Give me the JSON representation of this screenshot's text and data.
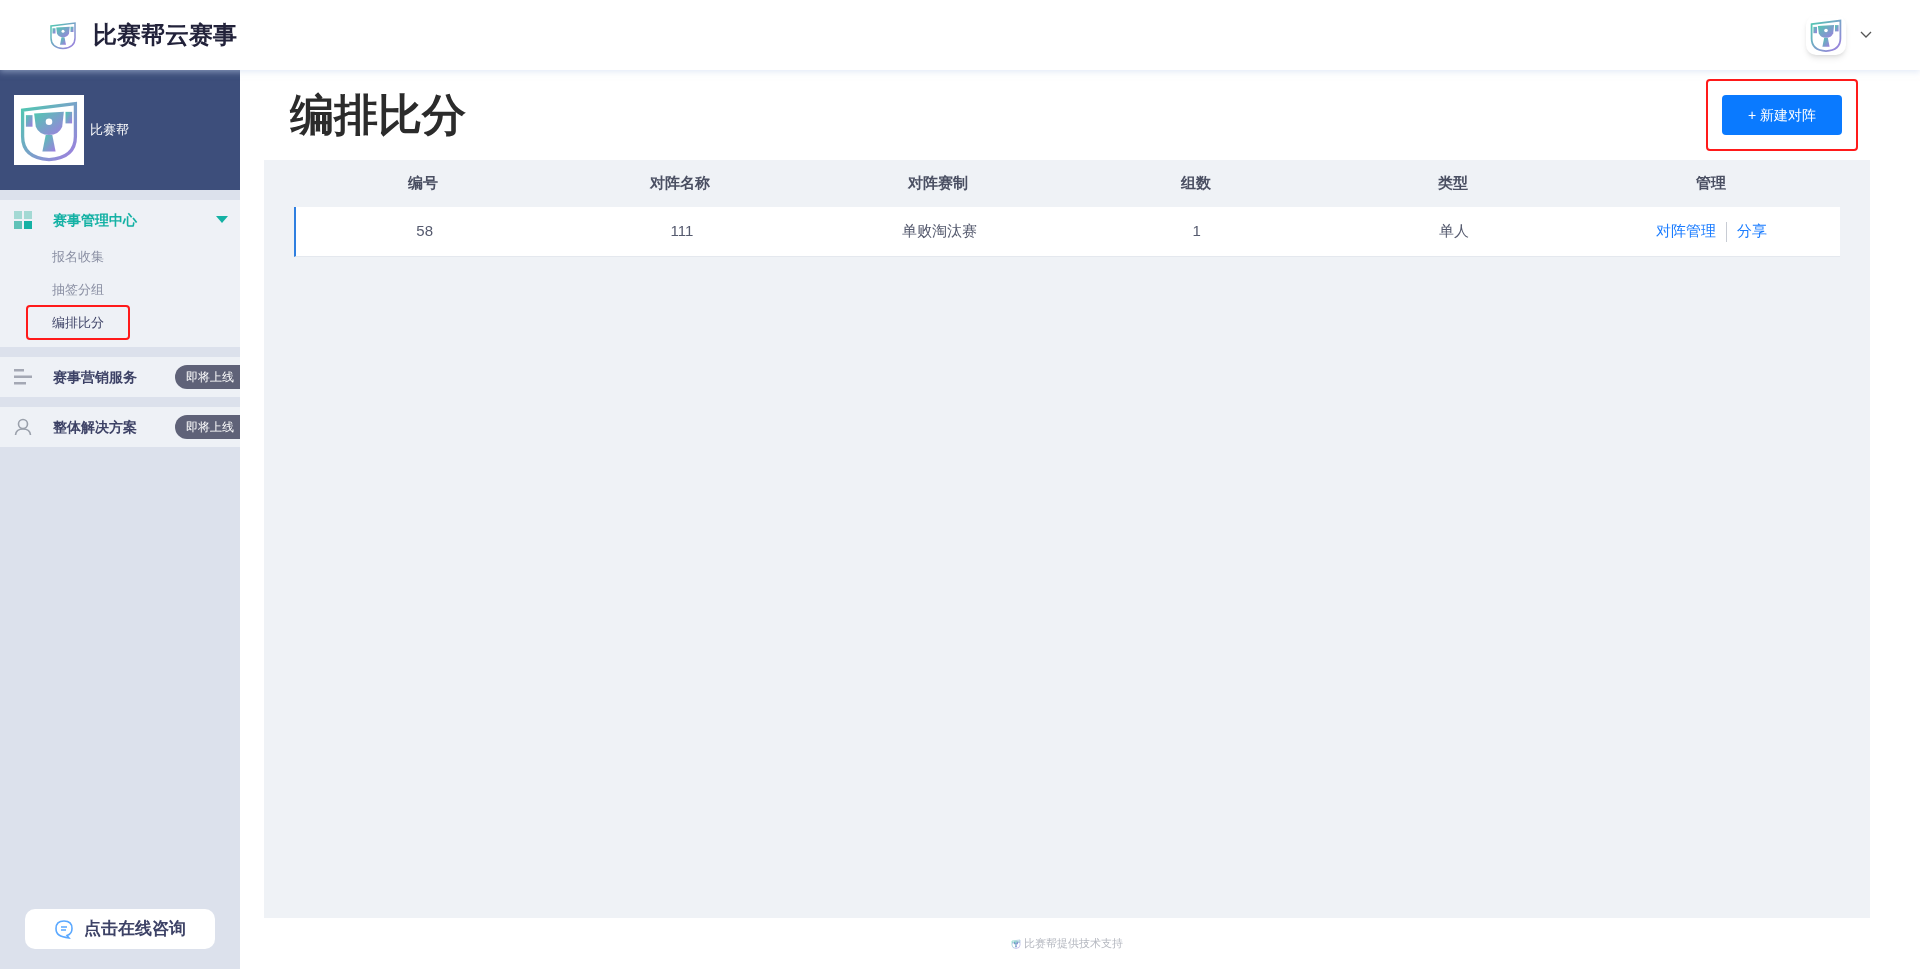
{
  "header": {
    "brand": "比赛帮云赛事"
  },
  "sidebar": {
    "org_name": "比赛帮",
    "groups": [
      {
        "label": "赛事管理中心",
        "kind": "tiles",
        "expanded": true,
        "items": [
          {
            "label": "报名收集",
            "selected": false
          },
          {
            "label": "抽签分组",
            "selected": false
          },
          {
            "label": "编排比分",
            "selected": true
          }
        ]
      },
      {
        "label": "赛事营销服务",
        "kind": "bars",
        "expanded": false,
        "badge": "即将上线"
      },
      {
        "label": "整体解决方案",
        "kind": "person",
        "expanded": false,
        "badge": "即将上线"
      }
    ],
    "consult_button": "点击在线咨询"
  },
  "page": {
    "title": "编排比分",
    "new_button": "+ 新建对阵"
  },
  "table": {
    "columns": [
      "编号",
      "对阵名称",
      "对阵赛制",
      "组数",
      "类型",
      "管理"
    ],
    "rows": [
      {
        "cells": [
          "58",
          "111",
          "单败淘汰赛",
          "1",
          "单人"
        ],
        "actions": [
          "对阵管理",
          "分享"
        ]
      }
    ]
  },
  "footer": "比赛帮提供技术支持"
}
